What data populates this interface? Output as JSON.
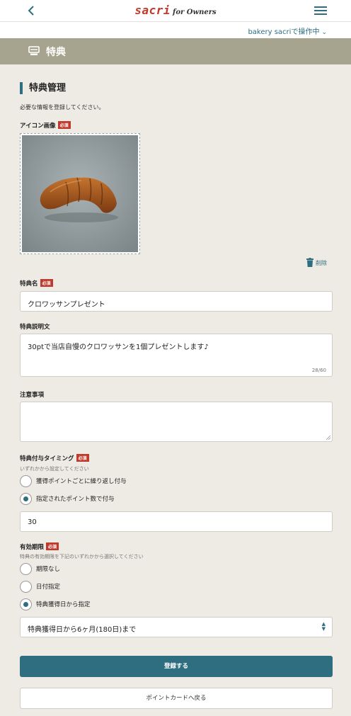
{
  "header": {
    "brand": "sacri",
    "brand_sub": "for Owners",
    "store_switch": "bakery sacriで操作中"
  },
  "band": {
    "title": "特典"
  },
  "section": {
    "title": "特典管理",
    "intro": "必要な情報を登録してください。"
  },
  "required_badge": "必須",
  "icon_image": {
    "label": "アイコン画像",
    "delete_label": "削除"
  },
  "benefit_name": {
    "label": "特典名",
    "value": "クロワッサンプレゼント"
  },
  "benefit_description": {
    "label": "特典説明文",
    "value": "30ptで当店自慢のクロワッサンを1個プレゼントします♪",
    "counter": "28/60"
  },
  "notes": {
    "label": "注意事項",
    "value": ""
  },
  "timing": {
    "label": "特典付与タイミング",
    "hint": "いずれかから設定してください",
    "options": [
      {
        "label": "獲得ポイントごとに繰り返し付与",
        "selected": false
      },
      {
        "label": "指定されたポイント数で付与",
        "selected": true
      }
    ],
    "points_value": "30"
  },
  "expiry": {
    "label": "有効期限",
    "hint": "特典の有効期限を下記のいずれかから選択してください",
    "options": [
      {
        "label": "期限なし",
        "selected": false
      },
      {
        "label": "日付指定",
        "selected": false
      },
      {
        "label": "特典獲得日から指定",
        "selected": true
      }
    ],
    "select_value": "特典獲得日から6ヶ月(180日)まで"
  },
  "actions": {
    "submit_label": "登録する",
    "back_label": "ポイントカードへ戻る"
  },
  "colors": {
    "accent": "#2e6e80",
    "required": "#c0392b",
    "band": "#a6a48f",
    "background": "#edebe3"
  },
  "icons": [
    "chevron-left-icon",
    "menu-icon",
    "chevron-down-icon",
    "register-icon",
    "trash-icon",
    "select-arrows-icon"
  ]
}
